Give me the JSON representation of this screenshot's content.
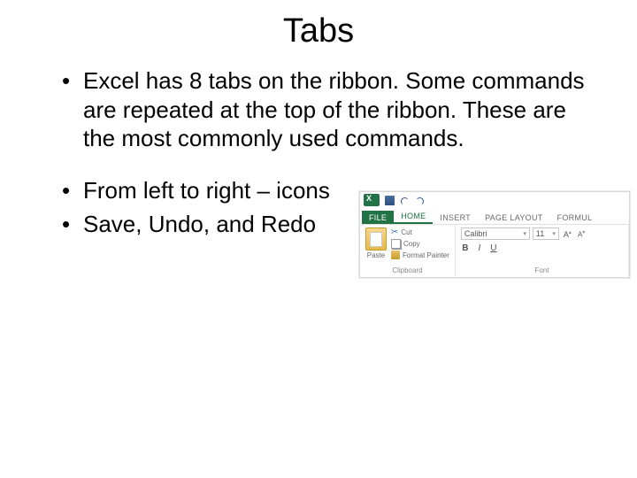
{
  "title": "Tabs",
  "bullets": [
    "Excel has 8 tabs on the ribbon.  Some commands are repeated at the top of the ribbon.  These are the most commonly used commands.",
    "From left to right – icons",
    "Save, Undo, and Redo"
  ],
  "ribbon": {
    "tabs": {
      "file": "FILE",
      "home": "HOME",
      "insert": "INSERT",
      "pagelayout": "PAGE LAYOUT",
      "formulas": "FORMUL"
    },
    "clipboard": {
      "paste": "Paste",
      "cut": "Cut",
      "copy": "Copy",
      "formatPainter": "Format Painter",
      "label": "Clipboard"
    },
    "font": {
      "name": "Calibri",
      "size": "11",
      "increase": "A",
      "decrease": "A",
      "bold": "B",
      "italic": "I",
      "underline": "U",
      "label": "Font"
    }
  }
}
